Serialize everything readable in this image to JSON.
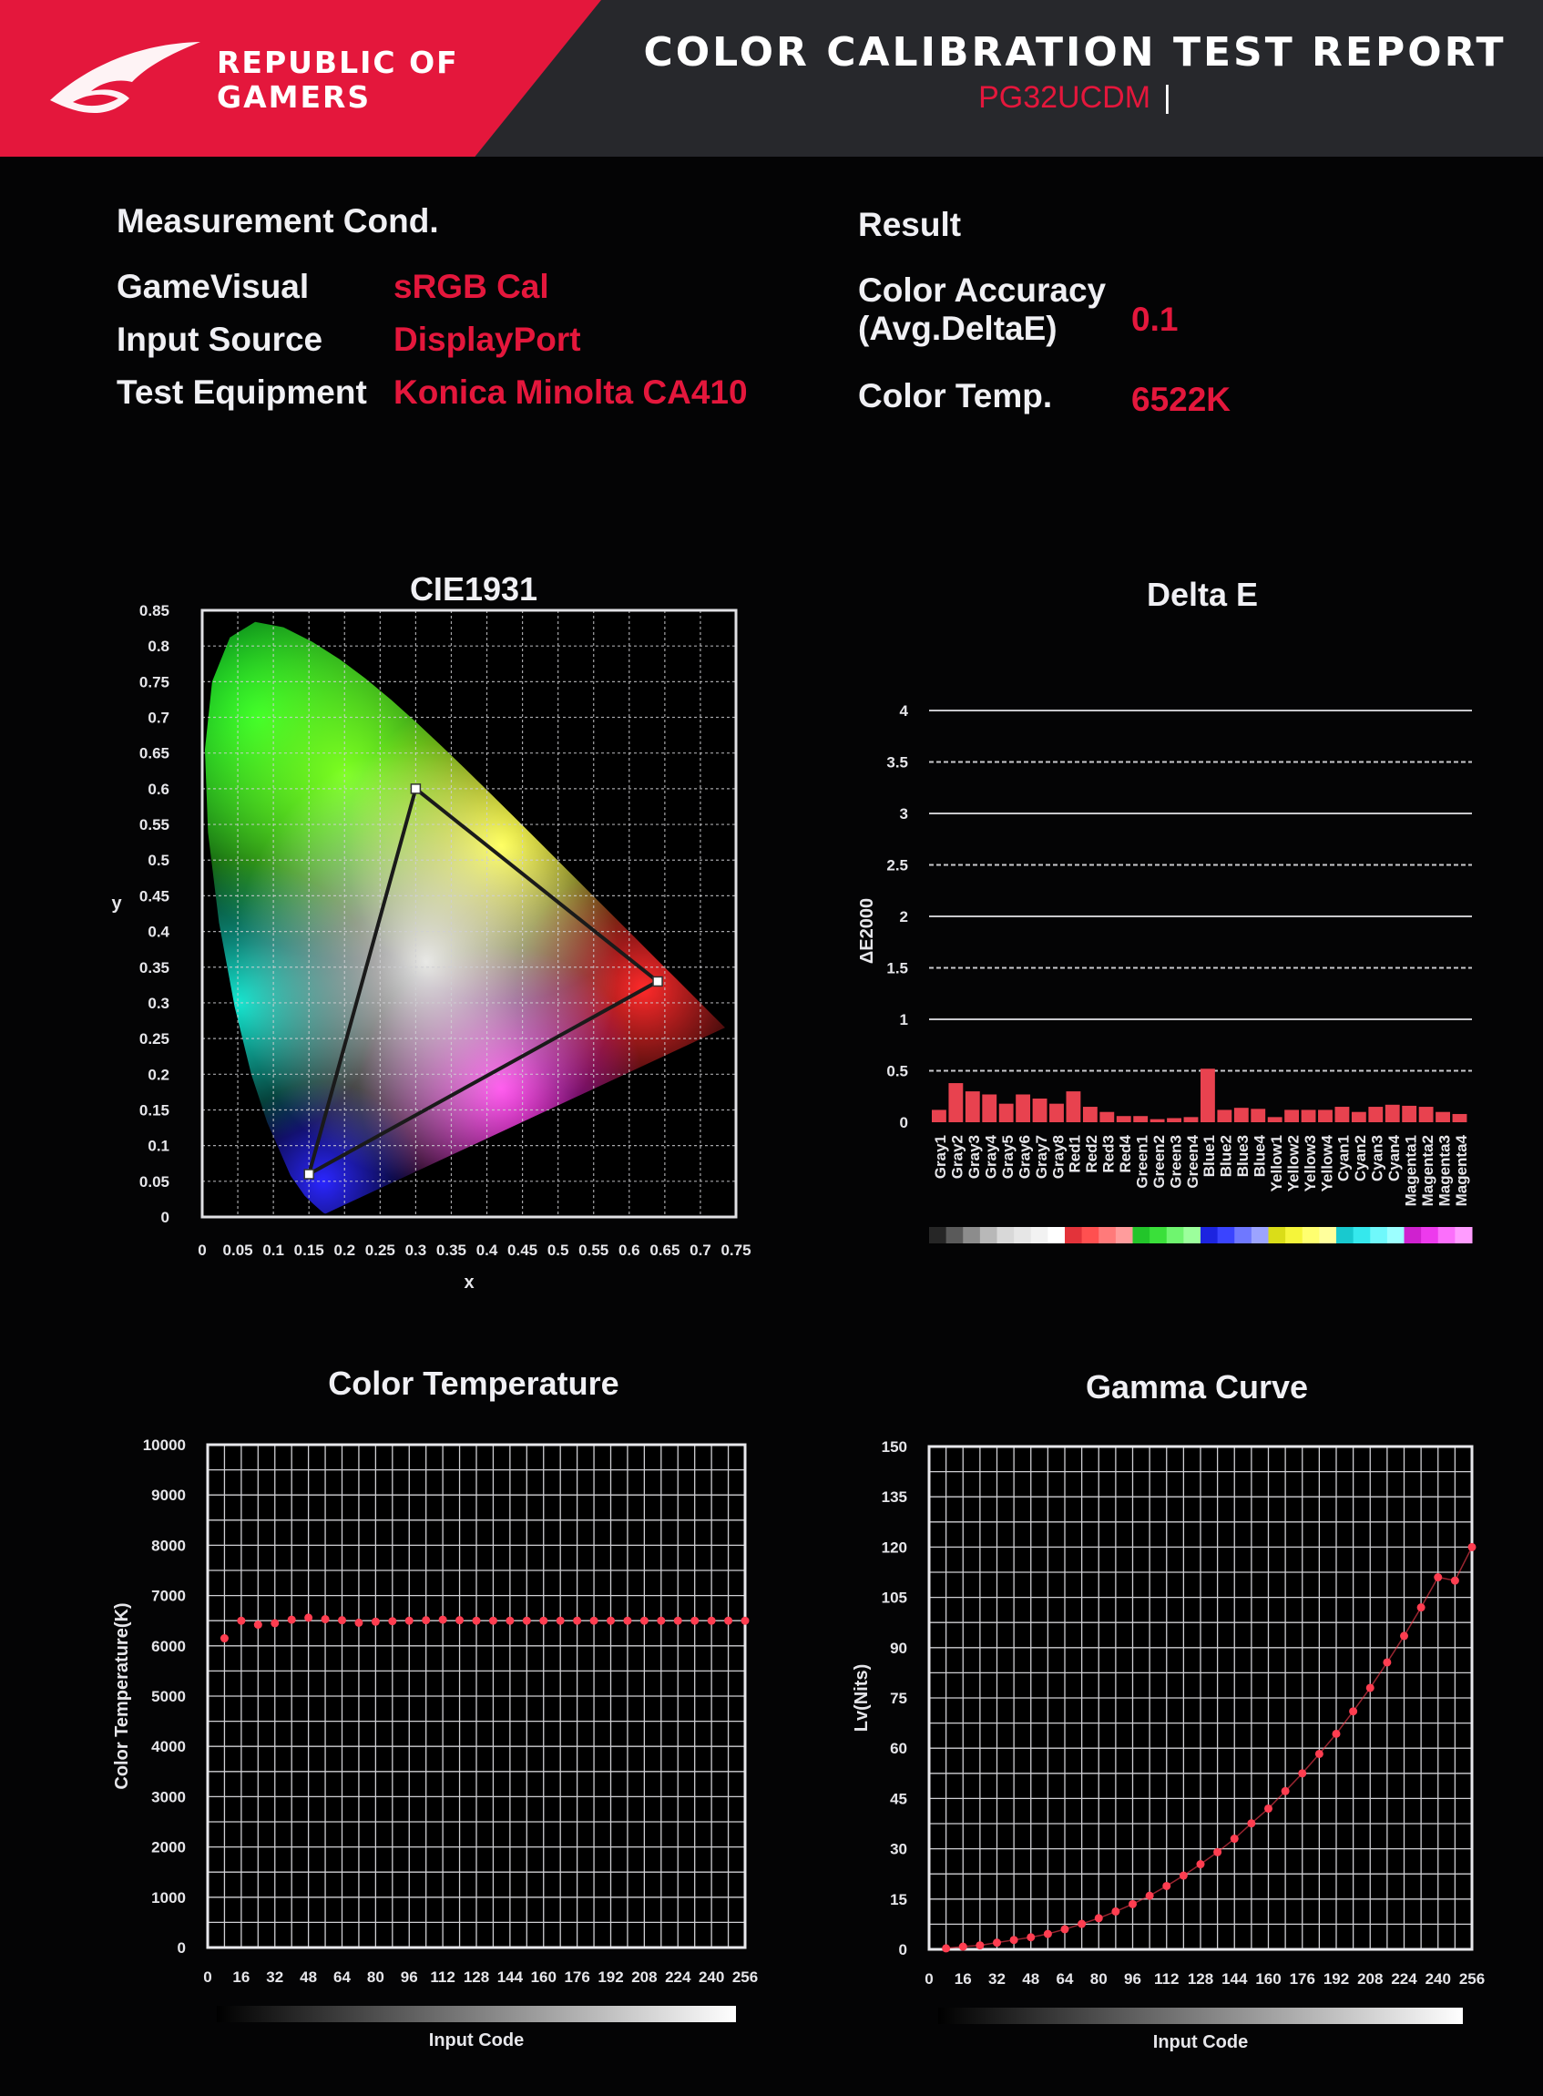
{
  "header": {
    "brand_line1": "REPUBLIC OF",
    "brand_line2": "GAMERS",
    "title": "COLOR CALIBRATION TEST REPORT",
    "model": "PG32UCDM",
    "logo_icon": "rog-eye-logo-icon",
    "brand_color": "#e4173c"
  },
  "measurement": {
    "title": "Measurement Cond.",
    "rows": [
      {
        "label": "GameVisual",
        "value": "sRGB Cal"
      },
      {
        "label": "Input Source",
        "value": "DisplayPort"
      },
      {
        "label": "Test Equipment",
        "value": "Konica Minolta CA410"
      }
    ]
  },
  "result": {
    "title": "Result",
    "accuracy_label_line1": "Color Accuracy",
    "accuracy_label_line2": "(Avg.DeltaE)",
    "accuracy_value": "0.1",
    "temp_label": "Color Temp.",
    "temp_value": "6522K"
  },
  "chart_data": [
    {
      "type": "scatter",
      "title": "CIE1931",
      "xlabel": "x",
      "ylabel": "y",
      "xlim": [
        0,
        0.75
      ],
      "ylim": [
        0,
        0.85
      ],
      "xticks": [
        "0",
        "0.05",
        "0.1",
        "0.15",
        "0.2",
        "0.25",
        "0.3",
        "0.35",
        "0.4",
        "0.45",
        "0.5",
        "0.55",
        "0.6",
        "0.65",
        "0.7",
        "0.75"
      ],
      "yticks": [
        "0",
        "0.05",
        "0.1",
        "0.15",
        "0.2",
        "0.25",
        "0.3",
        "0.35",
        "0.4",
        "0.45",
        "0.5",
        "0.55",
        "0.6",
        "0.65",
        "0.7",
        "0.75",
        "0.8",
        "0.85"
      ],
      "grid": true,
      "gamut_triangle": [
        {
          "x": 0.64,
          "y": 0.33
        },
        {
          "x": 0.3,
          "y": 0.6
        },
        {
          "x": 0.15,
          "y": 0.06
        }
      ]
    },
    {
      "type": "bar",
      "title": "Delta E",
      "ylabel": "ΔE2000",
      "ylim": [
        0,
        4
      ],
      "yticks": [
        "0",
        "0.5",
        "1",
        "1.5",
        "2",
        "2.5",
        "3",
        "3.5",
        "4"
      ],
      "bar_color": "#e8424f",
      "categories": [
        "Gray1",
        "Gray2",
        "Gray3",
        "Gray4",
        "Gray5",
        "Gray6",
        "Gray7",
        "Gray8",
        "Red1",
        "Red2",
        "Red3",
        "Red4",
        "Green1",
        "Green2",
        "Green3",
        "Green4",
        "Blue1",
        "Blue2",
        "Blue3",
        "Blue4",
        "Yellow1",
        "Yellow2",
        "Yellow3",
        "Yellow4",
        "Cyan1",
        "Cyan2",
        "Cyan3",
        "Cyan4",
        "Magenta1",
        "Magenta2",
        "Magenta3",
        "Magenta4"
      ],
      "values": [
        0.12,
        0.38,
        0.3,
        0.27,
        0.18,
        0.27,
        0.23,
        0.18,
        0.3,
        0.15,
        0.1,
        0.06,
        0.06,
        0.03,
        0.04,
        0.05,
        0.52,
        0.12,
        0.14,
        0.13,
        0.05,
        0.12,
        0.12,
        0.12,
        0.15,
        0.1,
        0.15,
        0.17,
        0.16,
        0.15,
        0.1,
        0.08
      ],
      "swatches": [
        "#262626",
        "#5a5a5a",
        "#8c8c8c",
        "#b8b8b8",
        "#d8d8d8",
        "#e6e6e6",
        "#f2f2f2",
        "#ffffff",
        "#e3333a",
        "#ff5050",
        "#ff7a7a",
        "#ff9c9c",
        "#22c52a",
        "#3ae03a",
        "#6ff56f",
        "#9cff9c",
        "#1c24e0",
        "#3a44ff",
        "#6f78ff",
        "#9ca4ff",
        "#dadd18",
        "#f5f53a",
        "#ffff6f",
        "#ffff9c",
        "#18c9cf",
        "#35e8ed",
        "#6ff8fb",
        "#9cffff",
        "#cf21cf",
        "#ed3aed",
        "#fb6ffb",
        "#ff9cff"
      ]
    },
    {
      "type": "scatter",
      "title": "Color Temperature",
      "xlabel": "Input Code",
      "ylabel": "Color Temperature(K)",
      "xlim": [
        0,
        256
      ],
      "ylim": [
        0,
        10000
      ],
      "xticks": [
        "0",
        "16",
        "32",
        "48",
        "64",
        "80",
        "96",
        "112",
        "128",
        "144",
        "160",
        "176",
        "192",
        "208",
        "224",
        "240",
        "256"
      ],
      "yticks": [
        "0",
        "1000",
        "2000",
        "3000",
        "4000",
        "5000",
        "6000",
        "7000",
        "8000",
        "9000",
        "10000"
      ],
      "marker_color": "#ff3d50",
      "x": [
        8,
        16,
        24,
        32,
        40,
        48,
        56,
        64,
        72,
        80,
        88,
        96,
        104,
        112,
        120,
        128,
        136,
        144,
        152,
        160,
        168,
        176,
        184,
        192,
        200,
        208,
        216,
        224,
        232,
        240,
        248,
        256
      ],
      "y": [
        6150,
        6500,
        6420,
        6450,
        6520,
        6560,
        6530,
        6510,
        6460,
        6480,
        6490,
        6500,
        6510,
        6520,
        6510,
        6500,
        6500,
        6500,
        6500,
        6500,
        6500,
        6500,
        6500,
        6500,
        6500,
        6500,
        6500,
        6500,
        6500,
        6500,
        6500,
        6500
      ]
    },
    {
      "type": "line",
      "title": "Gamma Curve",
      "xlabel": "Input Code",
      "ylabel": "Lv(Nits)",
      "xlim": [
        0,
        256
      ],
      "ylim": [
        0,
        150
      ],
      "xticks": [
        "0",
        "16",
        "32",
        "48",
        "64",
        "80",
        "96",
        "112",
        "128",
        "144",
        "160",
        "176",
        "192",
        "208",
        "224",
        "240",
        "256"
      ],
      "yticks": [
        "0",
        "15",
        "30",
        "45",
        "60",
        "75",
        "90",
        "105",
        "120",
        "135",
        "150"
      ],
      "marker_color": "#ff3d50",
      "x": [
        8,
        16,
        24,
        32,
        40,
        48,
        56,
        64,
        72,
        80,
        88,
        96,
        104,
        112,
        120,
        128,
        136,
        144,
        152,
        160,
        168,
        176,
        184,
        192,
        200,
        208,
        216,
        224,
        232,
        240,
        248,
        256
      ],
      "y": [
        0.3,
        0.8,
        1.2,
        2,
        2.8,
        3.6,
        4.6,
        6,
        7.6,
        9.3,
        11.3,
        13.5,
        16,
        18.9,
        22,
        25.4,
        29,
        33,
        37.6,
        42,
        47.2,
        52.5,
        58.3,
        64.3,
        71,
        78,
        85.6,
        93.5,
        102,
        111,
        110,
        120
      ]
    }
  ]
}
